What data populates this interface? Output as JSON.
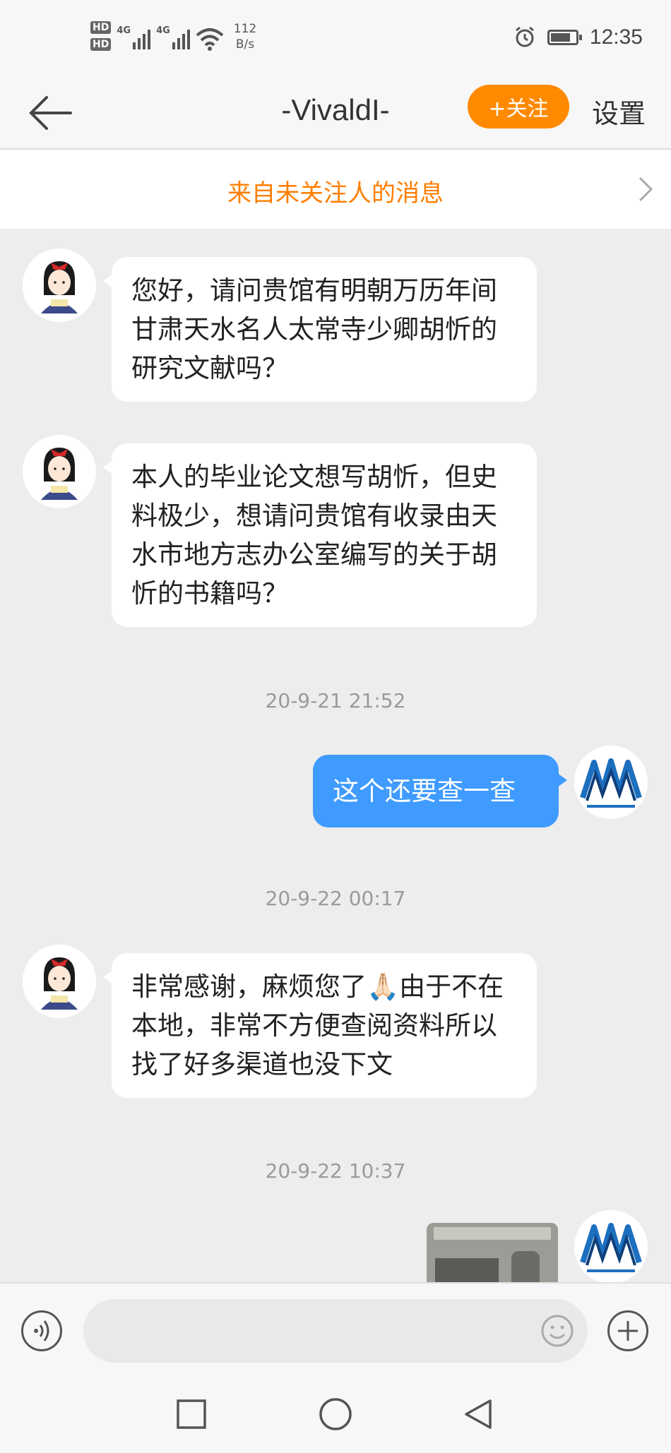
{
  "status_bar": {
    "hd1": "HD",
    "hd2": "HD",
    "net1": "4G",
    "net2": "4G",
    "speed_value": "112",
    "speed_unit": "B/s",
    "time": "12:35"
  },
  "header": {
    "title": "-VivaldI-",
    "follow_label": "+关注",
    "settings_label": "设置"
  },
  "notice": {
    "text": "来自未关注人的消息"
  },
  "messages": [
    {
      "side": "left",
      "text": "您好，请问贵馆有明朝万历年间甘肃天水名人太常寺少卿胡忻的研究文献吗？"
    },
    {
      "side": "left",
      "text": "本人的毕业论文想写胡忻，但史料极少，想请问贵馆有收录由天水市地方志办公室编写的关于胡忻的书籍吗？"
    },
    {
      "side": "right",
      "text": "这个还要查一查"
    },
    {
      "side": "left",
      "text": "非常感谢，麻烦您了🙏🏻由于不在本地，非常不方便查阅资料所以找了好多渠道也没下文"
    }
  ],
  "timestamps": [
    "20-9-21 21:52",
    "20-9-22 00:17",
    "20-9-22 10:37"
  ],
  "colors": {
    "accent_orange": "#ff8a00",
    "bubble_blue": "#3f9bff",
    "chat_bg": "#ededed"
  }
}
